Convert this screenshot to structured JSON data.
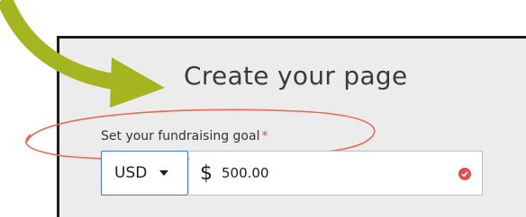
{
  "page": {
    "title": "Create your page",
    "goal_label": "Set your fundraising goal",
    "required_mark": "*"
  },
  "currency": {
    "selected": "USD",
    "symbol": "$"
  },
  "amount": {
    "value": "500.00"
  },
  "colors": {
    "arrow": "#a5b51f",
    "highlight_ellipse": "#e8695a",
    "focus_border": "#3b76d9",
    "valid_check": "#e0504e"
  },
  "icons": {
    "arrow": "curved-arrow-icon",
    "dropdown": "chevron-down-icon",
    "valid": "check-circle-icon"
  }
}
